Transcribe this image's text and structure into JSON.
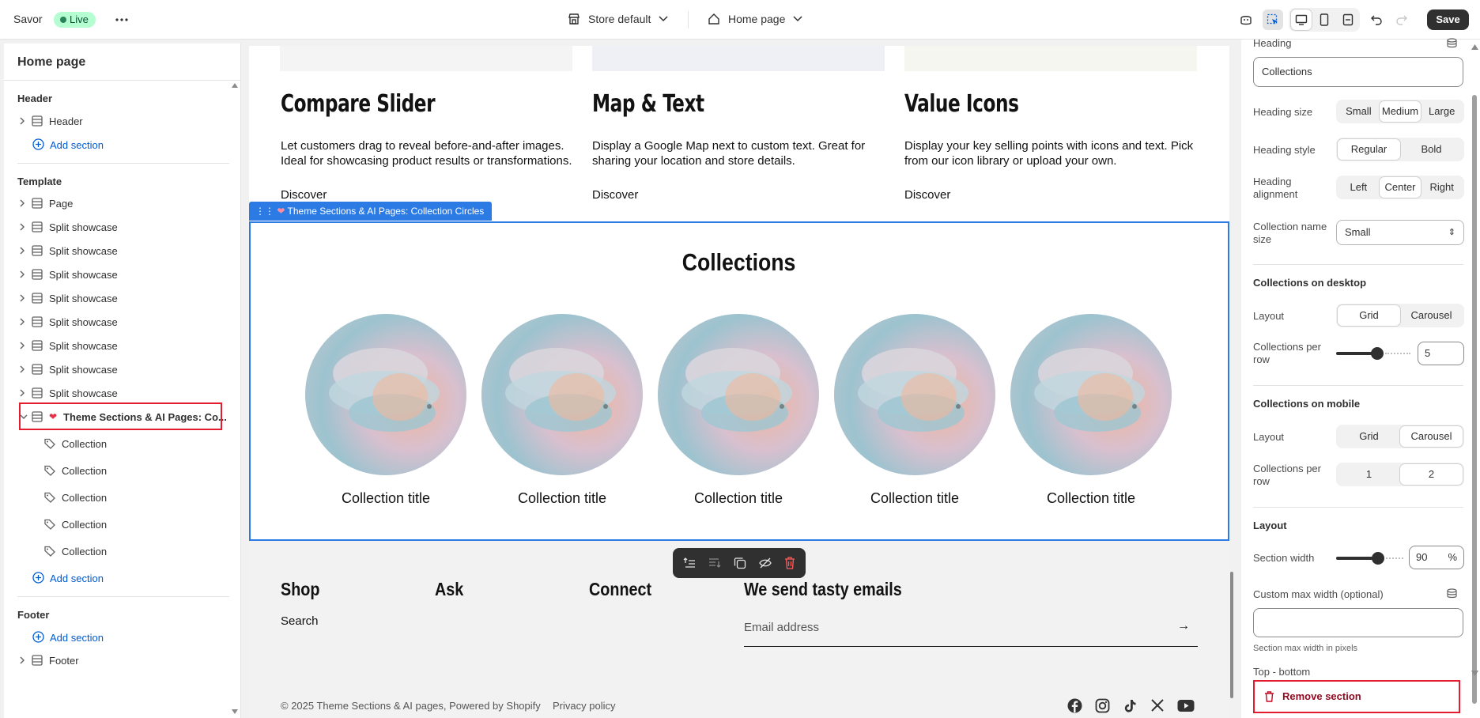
{
  "topbar": {
    "store_name": "Savor",
    "status": "Live",
    "theme_selector": "Store default",
    "page_selector": "Home page",
    "save_label": "Save"
  },
  "sidebar": {
    "title": "Home page",
    "header_group": "Header",
    "header_item": "Header",
    "add_section": "Add section",
    "template_group": "Template",
    "template_items": [
      "Page",
      "Split showcase",
      "Split showcase",
      "Split showcase",
      "Split showcase",
      "Split showcase",
      "Split showcase",
      "Split showcase",
      "Split showcase"
    ],
    "selected_item": "Theme Sections & AI Pages: Co...",
    "blocks": [
      "Collection",
      "Collection",
      "Collection",
      "Collection",
      "Collection"
    ],
    "footer_group": "Footer",
    "footer_item": "Footer"
  },
  "preview": {
    "features": [
      {
        "title": "Compare Slider",
        "desc": "Let customers drag to reveal before-and-after images. Ideal for showcasing product results or transformations.",
        "link": "Discover"
      },
      {
        "title": "Map & Text",
        "desc": "Display a Google Map next to custom text. Great for sharing your location and store details.",
        "link": "Discover"
      },
      {
        "title": "Value Icons",
        "desc": "Display your key selling points with icons and text. Pick from our icon library or upload your own.",
        "link": "Discover"
      }
    ],
    "section_tag": "Theme Sections & AI Pages: Collection Circles",
    "section_heading": "Collections",
    "collection_titles": [
      "Collection title",
      "Collection title",
      "Collection title",
      "Collection title",
      "Collection title"
    ],
    "footer": {
      "shop": "Shop",
      "search": "Search",
      "ask": "Ask",
      "connect": "Connect",
      "newsletter": "We send tasty emails",
      "email_placeholder": "Email address",
      "copyright": "© 2025 Theme Sections & AI pages, Powered by Shopify",
      "privacy": "Privacy policy"
    }
  },
  "settings": {
    "heading_label": "Heading",
    "heading_value": "Collections",
    "heading_size_label": "Heading size",
    "heading_size_options": [
      "Small",
      "Medium",
      "Large"
    ],
    "heading_style_label": "Heading style",
    "heading_style_options": [
      "Regular",
      "Bold"
    ],
    "heading_alignment_label": "Heading alignment",
    "heading_alignment_options": [
      "Left",
      "Center",
      "Right"
    ],
    "collection_name_size_label": "Collection name size",
    "collection_name_size_value": "Small",
    "desktop_title": "Collections on desktop",
    "layout_label": "Layout",
    "desktop_layout_options": [
      "Grid",
      "Carousel"
    ],
    "per_row_label": "Collections per row",
    "desktop_per_row": "5",
    "mobile_title": "Collections on mobile",
    "mobile_layout_options": [
      "Grid",
      "Carousel"
    ],
    "mobile_per_row_options": [
      "1",
      "2"
    ],
    "layout_title": "Layout",
    "section_width_label": "Section width",
    "section_width_value": "90",
    "section_width_unit": "%",
    "custom_max_label": "Custom max width (optional)",
    "custom_max_help": "Section max width in pixels",
    "top_bottom_label": "Top - bottom",
    "remove_section": "Remove section"
  }
}
